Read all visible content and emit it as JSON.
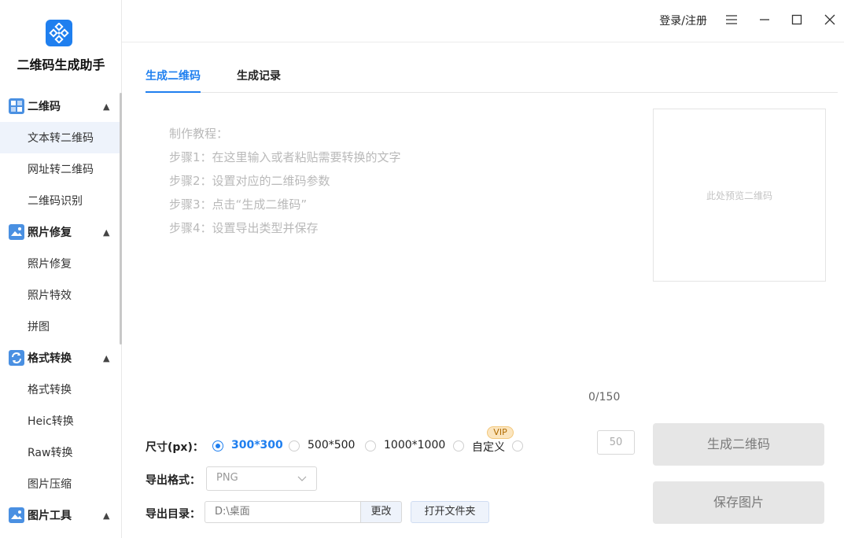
{
  "app": {
    "name": "二维码生成助手"
  },
  "sidebar": {
    "groups": [
      {
        "label": "二维码",
        "icon": "qrcode-icon",
        "color": "#4a90e2",
        "items": [
          {
            "label": "文本转二维码",
            "active": true
          },
          {
            "label": "网址转二维码"
          },
          {
            "label": "二维码识别"
          }
        ]
      },
      {
        "label": "照片修复",
        "icon": "photo-repair-icon",
        "color": "#4a90e2",
        "items": [
          {
            "label": "照片修复"
          },
          {
            "label": "照片特效"
          },
          {
            "label": "拼图"
          }
        ]
      },
      {
        "label": "格式转换",
        "icon": "format-convert-icon",
        "color": "#4a90e2",
        "items": [
          {
            "label": "格式转换"
          },
          {
            "label": "Heic转换"
          },
          {
            "label": "Raw转换"
          },
          {
            "label": "图片压缩"
          }
        ]
      },
      {
        "label": "图片工具",
        "icon": "image-tools-icon",
        "color": "#4a90e2",
        "items": []
      }
    ]
  },
  "topbar": {
    "login": "登录/注册"
  },
  "tabs": [
    {
      "label": "生成二维码",
      "active": true
    },
    {
      "label": "生成记录"
    }
  ],
  "editor": {
    "tutorial": [
      "制作教程：",
      "步骤1：在这里输入或者粘贴需要转换的文字",
      "步骤2：设置对应的二维码参数",
      "步骤3：点击“生成二维码”",
      "步骤4：设置导出类型并保存"
    ],
    "counter": "0/150"
  },
  "preview": {
    "placeholder": "此处预览二维码"
  },
  "options": {
    "size_label": "尺寸(px)：",
    "sizes": [
      {
        "label": "300*300",
        "checked": true
      },
      {
        "label": "500*500"
      },
      {
        "label": "1000*1000"
      },
      {
        "label": "自定义"
      }
    ],
    "vip": "VIP",
    "custom_value": "50",
    "format_label": "导出格式：",
    "format_value": "PNG",
    "dir_label": "导出目录：",
    "dir_value": "D:\\桌面",
    "change_label": "更改",
    "open_folder_label": "打开文件夹"
  },
  "actions": {
    "generate": "生成二维码",
    "save": "保存图片"
  },
  "colors": {
    "accent": "#1f7fef",
    "disabled_button": "#e6e6e6"
  }
}
